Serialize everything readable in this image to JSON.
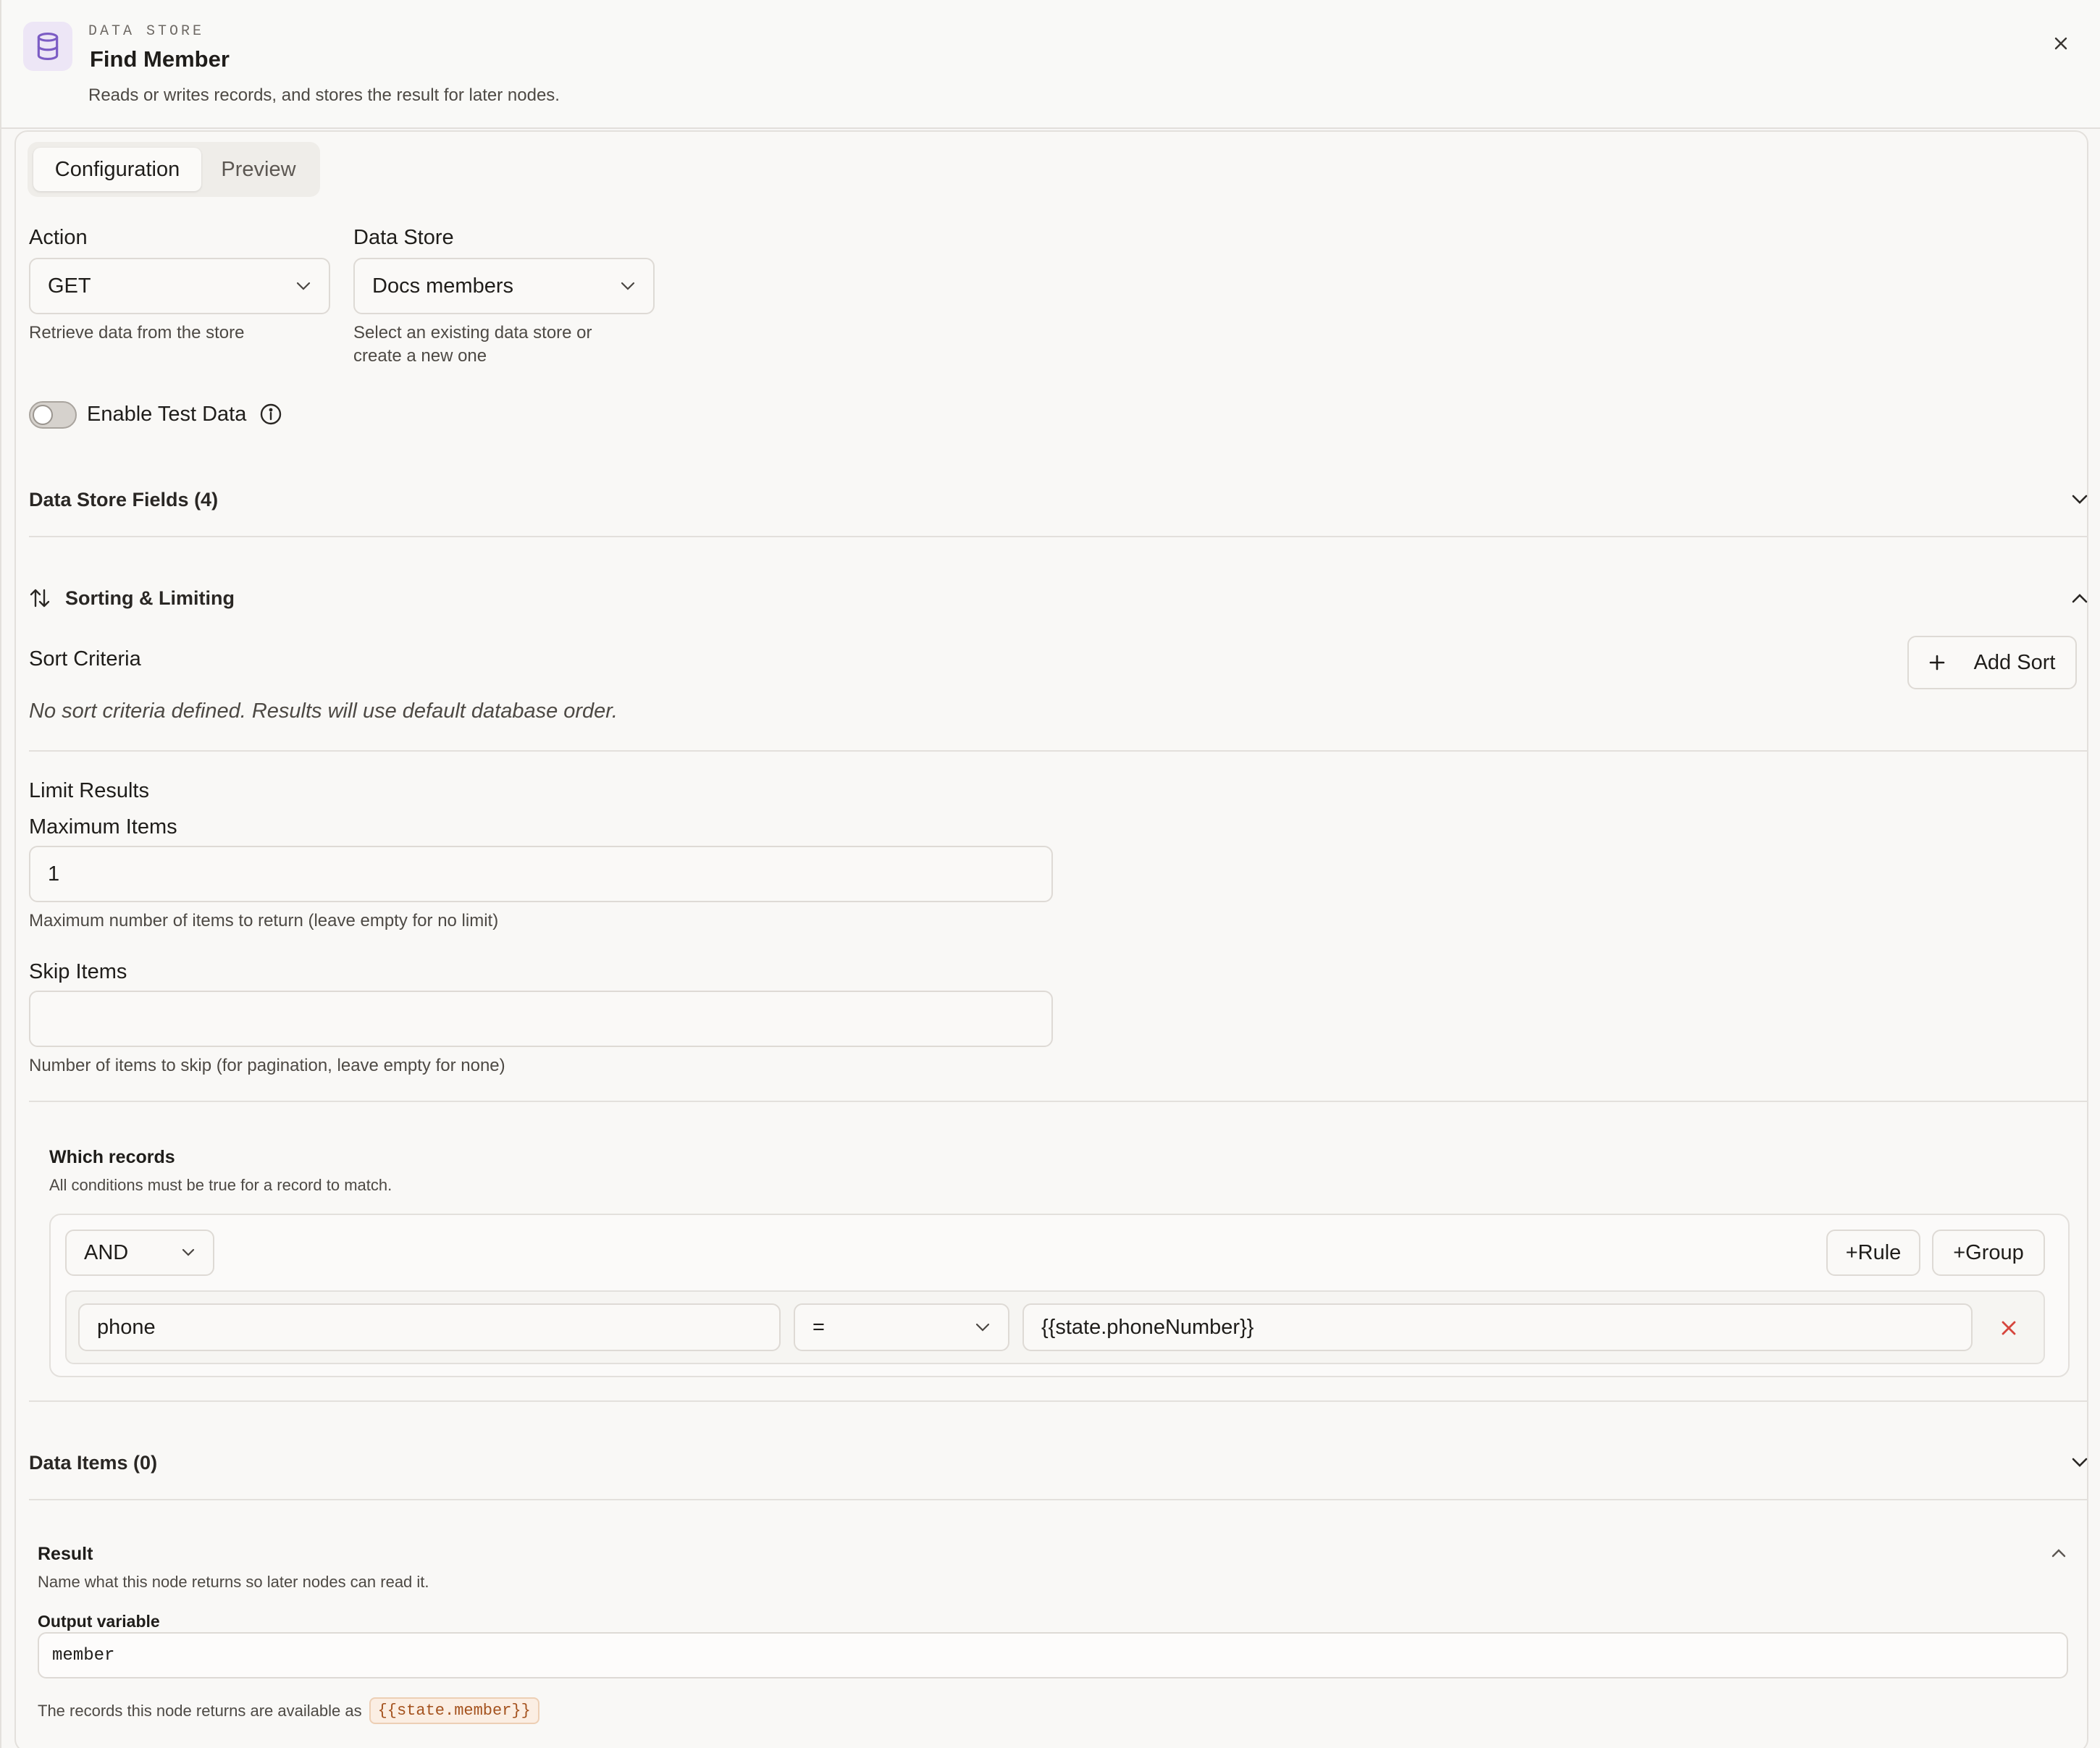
{
  "header": {
    "eyebrow": "DATA STORE",
    "title": "Find Member",
    "description": "Reads or writes records, and stores the result for later nodes.",
    "icon": "database-icon",
    "icon_color": "#7c5cc4"
  },
  "tabs": [
    {
      "label": "Configuration",
      "active": true
    },
    {
      "label": "Preview",
      "active": false
    }
  ],
  "action": {
    "label": "Action",
    "value": "GET",
    "help": "Retrieve data from the store"
  },
  "data_store": {
    "label": "Data Store",
    "value": "Docs members",
    "help_line1": "Select an existing data store or",
    "help_line2": "create a new one"
  },
  "test_data": {
    "label": "Enable Test Data",
    "enabled": false
  },
  "fields_section": {
    "title": "Data Store Fields (4)"
  },
  "sorting": {
    "title": "Sorting & Limiting",
    "sort_criteria_label": "Sort Criteria",
    "add_sort_label": "Add Sort",
    "empty_text": "No sort criteria defined. Results will use default database order.",
    "limit_title": "Limit Results",
    "max_items_label": "Maximum Items",
    "max_items_value": "1",
    "max_items_help": "Maximum number of items to return (leave empty for no limit)",
    "skip_label": "Skip Items",
    "skip_value": "",
    "skip_help": "Number of items to skip (for pagination, leave empty for none)"
  },
  "records": {
    "title": "Which records",
    "subtitle": "All conditions must be true for a record to match.",
    "combinator": "AND",
    "add_rule_label": "+Rule",
    "add_group_label": "+Group",
    "rule": {
      "field": "phone",
      "operator": "=",
      "value": "{{state.phoneNumber}}"
    },
    "remove_color": "#d6453d"
  },
  "data_items": {
    "title": "Data Items (0)"
  },
  "result": {
    "title": "Result",
    "subtitle": "Name what this node returns so later nodes can read it.",
    "output_label": "Output variable",
    "output_value": "member",
    "footer_text": "The records this node returns are available as",
    "footer_token": "{{state.member}}"
  }
}
